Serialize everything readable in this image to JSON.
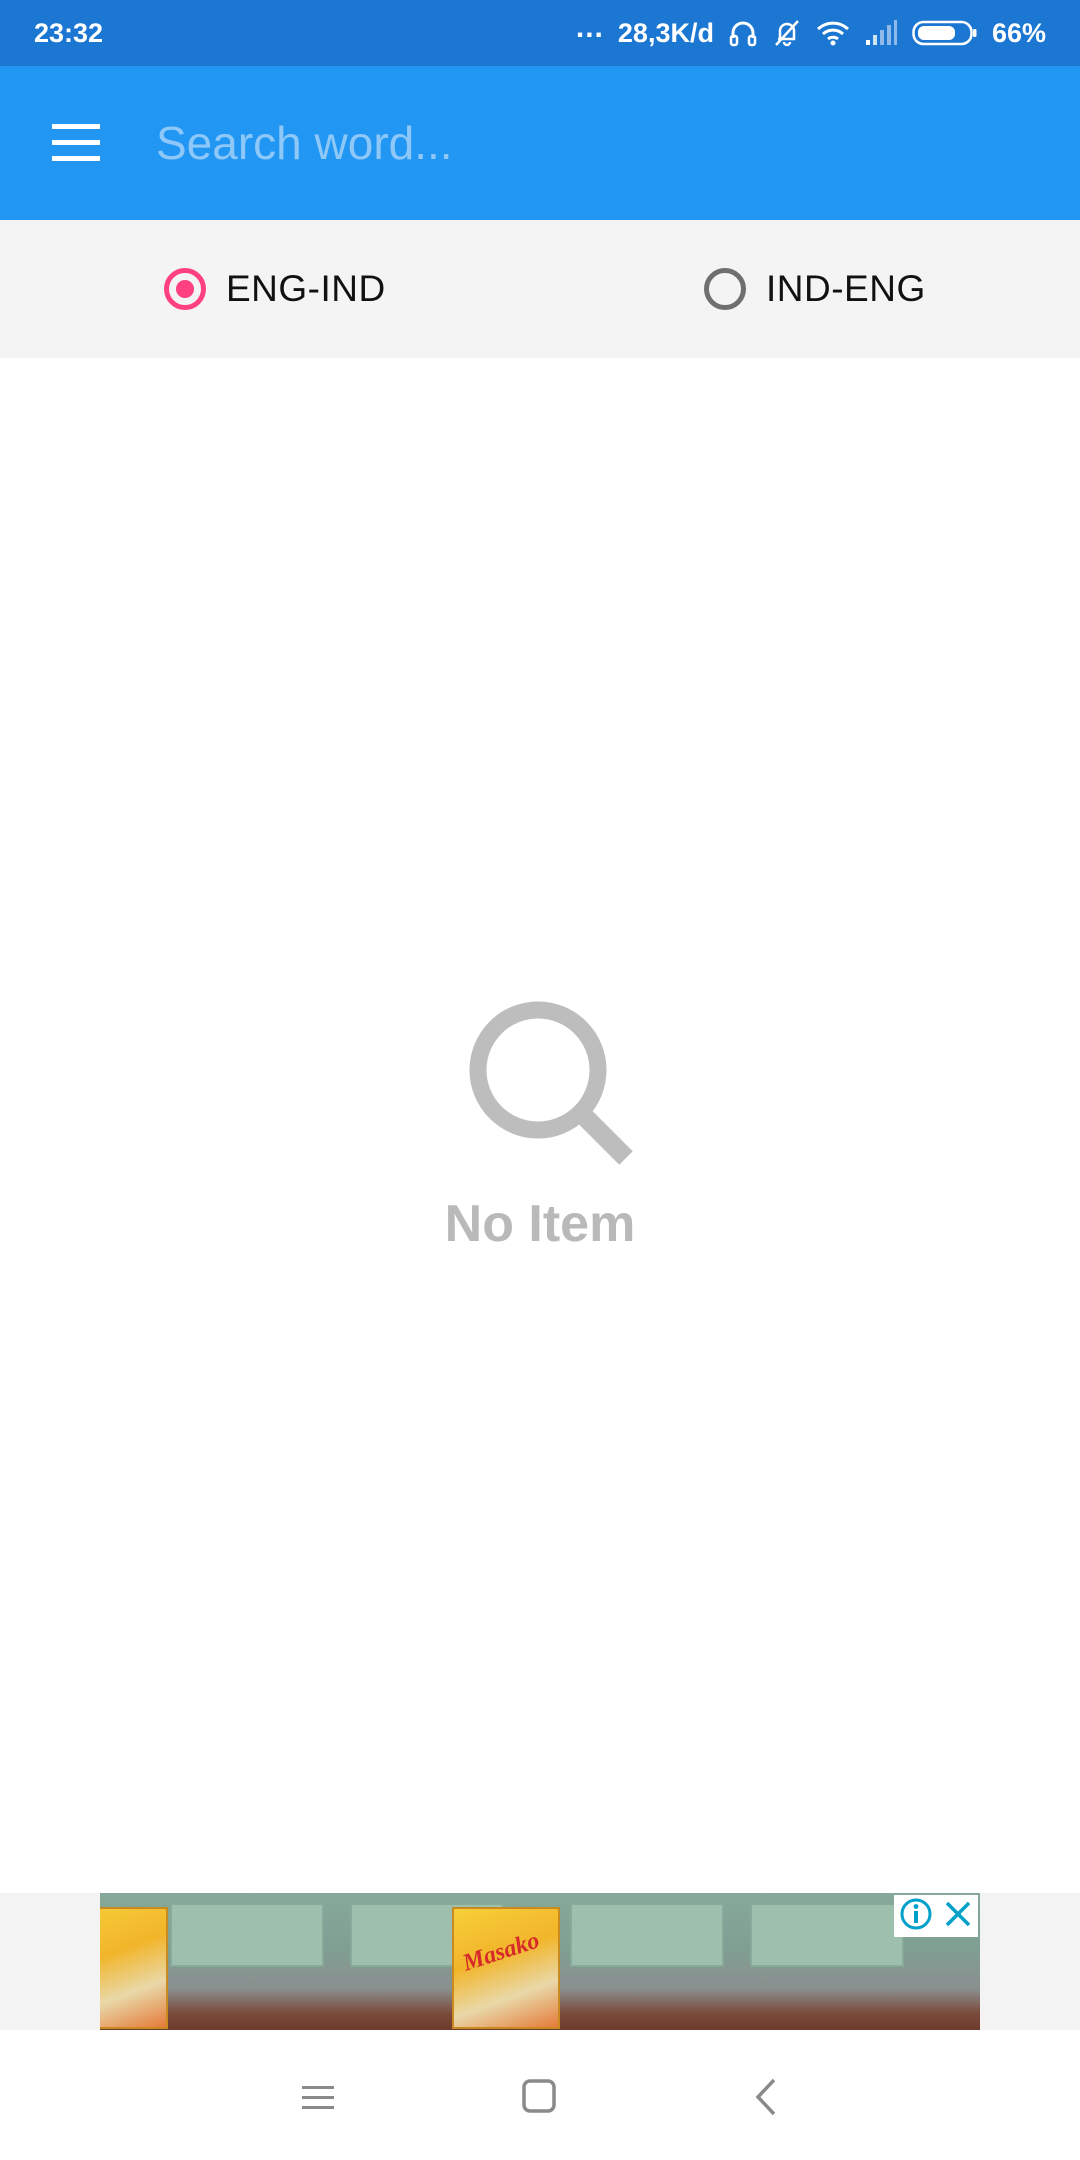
{
  "status_bar": {
    "time": "23:32",
    "dots": "...",
    "network_speed": "28,3K/d",
    "battery_percent": "66%",
    "icons": [
      "headphones-icon",
      "bell-off-icon",
      "wifi-icon",
      "signal-icon",
      "battery-icon"
    ]
  },
  "search": {
    "placeholder": "Search word...",
    "value": ""
  },
  "direction_toggle": {
    "options": [
      {
        "label": "ENG-IND",
        "selected": true
      },
      {
        "label": "IND-ENG",
        "selected": false
      }
    ]
  },
  "empty_state": {
    "icon": "search-icon",
    "text": "No Item"
  },
  "ad": {
    "brand_text": "Masako",
    "icons": [
      "info-icon",
      "close-icon"
    ]
  },
  "nav_bar": {
    "icons": [
      "recents-icon",
      "home-icon",
      "back-icon"
    ]
  },
  "colors": {
    "status_bar": "#1b77d2",
    "app_bar": "#2196f3",
    "accent": "#ff4081",
    "empty_text": "#b9b9b9",
    "placeholder": "#8ec8f8"
  }
}
